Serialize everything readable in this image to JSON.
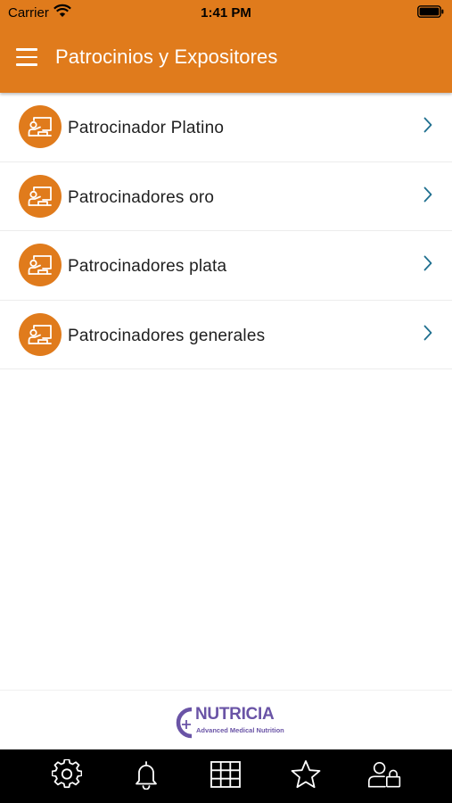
{
  "status_bar": {
    "carrier": "Carrier",
    "time": "1:41 PM"
  },
  "nav": {
    "title": "Patrocinios y Expositores",
    "menu_icon": "hamburger-menu-icon"
  },
  "list": {
    "items": [
      {
        "label": "Patrocinador Platino",
        "icon": "presentation-icon"
      },
      {
        "label": "Patrocinadores oro",
        "icon": "presentation-icon"
      },
      {
        "label": "Patrocinadores plata",
        "icon": "presentation-icon"
      },
      {
        "label": "Patrocinadores generales",
        "icon": "presentation-icon"
      }
    ]
  },
  "footer": {
    "brand_name": "NUTRICIA",
    "brand_tagline": "Advanced Medical Nutrition"
  },
  "tab_bar": {
    "tabs": [
      {
        "icon": "gear-icon"
      },
      {
        "icon": "bell-icon"
      },
      {
        "icon": "grid-icon"
      },
      {
        "icon": "star-icon"
      },
      {
        "icon": "user-lock-icon"
      }
    ]
  },
  "colors": {
    "accent": "#e07b1c",
    "chevron": "#1f6f8f",
    "logo": "#6a54a6",
    "tab_bar": "#000000"
  }
}
